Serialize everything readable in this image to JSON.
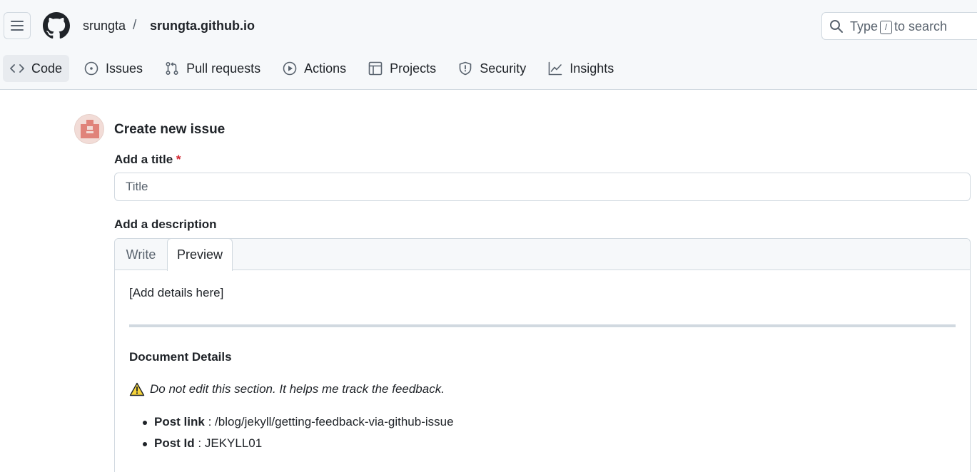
{
  "header": {
    "owner": "srungta",
    "separator": "/",
    "repo": "srungta.github.io",
    "search": {
      "prefix": "Type",
      "key": "/",
      "suffix": "to search"
    }
  },
  "nav": {
    "tabs": [
      {
        "label": "Code",
        "icon": "code-icon",
        "selected": true
      },
      {
        "label": "Issues",
        "icon": "issue-opened-icon"
      },
      {
        "label": "Pull requests",
        "icon": "git-pull-request-icon"
      },
      {
        "label": "Actions",
        "icon": "play-icon"
      },
      {
        "label": "Projects",
        "icon": "table-icon"
      },
      {
        "label": "Security",
        "icon": "shield-icon"
      },
      {
        "label": "Insights",
        "icon": "graph-icon"
      }
    ]
  },
  "form": {
    "heading": "Create new issue",
    "title_label": "Add a title",
    "required_mark": "*",
    "title_placeholder": "Title",
    "title_value": "",
    "description_label": "Add a description",
    "tabs": {
      "write": "Write",
      "preview": "Preview",
      "active": "Preview"
    }
  },
  "preview": {
    "details": "[Add details here]",
    "section_heading": "Document Details",
    "warning_icon": "warning-icon",
    "note": "Do not edit this section. It helps me track the feedback.",
    "items": [
      {
        "key": "Post link",
        "sep": " : ",
        "value": "/blog/jekyll/getting-feedback-via-github-issue"
      },
      {
        "key": "Post Id",
        "sep": " : ",
        "value": "JEKYLL01"
      }
    ]
  },
  "colors": {
    "header_bg": "#f6f8fa",
    "border": "#d1d9e0",
    "text": "#1f2328",
    "muted": "#59636e",
    "required": "#d1242f",
    "avatar": "#e0837a",
    "warning": "#f5d33b"
  }
}
